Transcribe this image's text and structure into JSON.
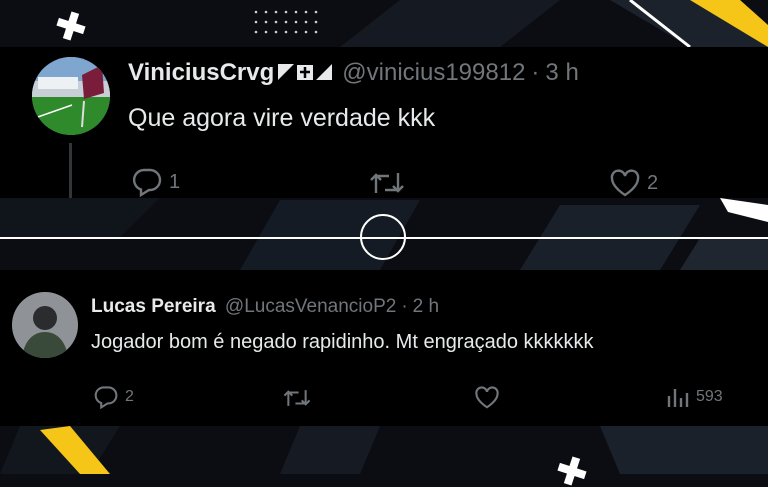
{
  "colors": {
    "background": "#0b0d12",
    "card": "#000000",
    "text": "#e7e9ea",
    "muted": "#71767b",
    "accent": "#f5c518",
    "lines": "#ffffff"
  },
  "tweets": [
    {
      "display_name": "ViniciusCrvg",
      "handle": "@vinicius199812",
      "time": "3 h",
      "text": "Que agora vire verdade kkk",
      "replies": "1",
      "retweets": "",
      "likes": "2",
      "avatar": "stadium-photo"
    },
    {
      "display_name": "Lucas Pereira",
      "handle": "@LucasVenancioP2",
      "time": "2 h",
      "text": "Jogador bom é negado rapidinho. Mt engraçado kkkkkkk",
      "replies": "2",
      "retweets": "",
      "likes": "",
      "views": "593",
      "avatar": "person-photo"
    }
  ],
  "separator": "·",
  "icons": {
    "reply": "reply-icon",
    "retweet": "retweet-icon",
    "like": "heart-icon",
    "views": "views-icon",
    "decoration": "plus-icon"
  }
}
